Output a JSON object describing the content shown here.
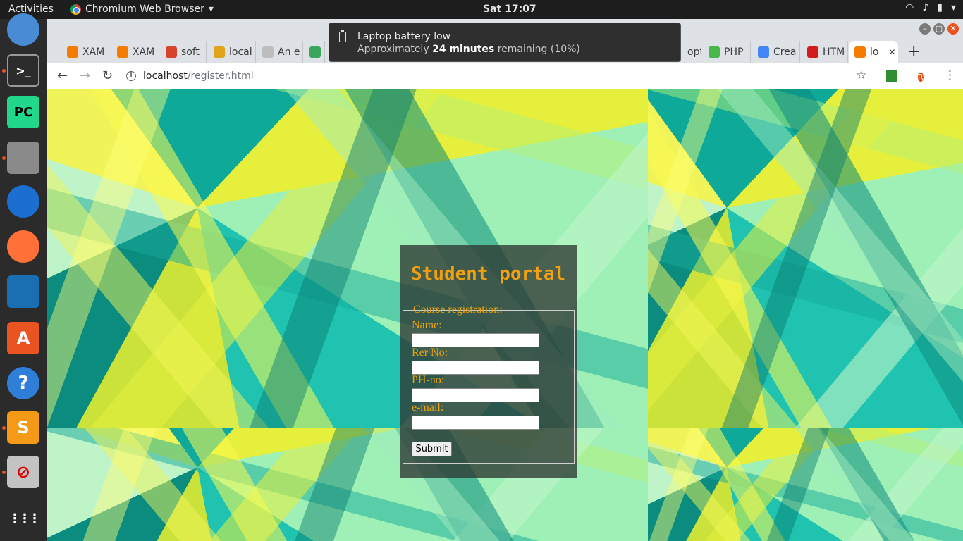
{
  "topbar": {
    "activities": "Activities",
    "app_name": "Chromium Web Browser",
    "app_menu_arrow": "▾",
    "clock": "Sat 17:07"
  },
  "notification": {
    "title": "Laptop battery low",
    "body_prefix": "Approximately ",
    "body_bold": "24 minutes",
    "body_suffix": " remaining (10%)"
  },
  "tabs": [
    {
      "label": "XAM",
      "icon_color": "#f57c00"
    },
    {
      "label": "XAM",
      "icon_color": "#f57c00"
    },
    {
      "label": "soft",
      "icon_color": "#d6452b"
    },
    {
      "label": "local",
      "icon_color": "#e0a41a"
    },
    {
      "label": "An e",
      "icon_color": "#bdbdbd"
    },
    {
      "label": "",
      "icon_color": "#3aa55c"
    },
    {
      "label": "opt",
      "icon_color": "#dee1e6"
    },
    {
      "label": "PHP",
      "icon_color": "#48b74b"
    },
    {
      "label": "Crea",
      "icon_color": "#4285f4"
    },
    {
      "label": "HTM",
      "icon_color": "#d31b1b"
    },
    {
      "label": "lo",
      "icon_color": "#f57c00"
    }
  ],
  "toolbar": {
    "back_icon": "←",
    "forward_icon": "→",
    "reload_icon": "↻",
    "info_icon": "i",
    "url_host": "localhost",
    "url_path": "/register.html",
    "star_icon": "☆",
    "avatar_letter": "R",
    "menu_icon": "⋮",
    "new_tab_icon": "+",
    "close_tab_icon": "✕"
  },
  "window_buttons": {
    "minimize": "–",
    "maximize": "▢",
    "close": "✕"
  },
  "form": {
    "title": "Student portal",
    "legend": "Course registration:",
    "fields": [
      {
        "label": "Name:",
        "value": ""
      },
      {
        "label": "Rer No:",
        "value": ""
      },
      {
        "label": "PH-no:",
        "value": ""
      },
      {
        "label": "e-mail:",
        "value": ""
      }
    ],
    "submit_label": "Submit"
  },
  "dock": [
    {
      "name": "chromium-icon",
      "color": "#4a8bd6"
    },
    {
      "name": "terminal-icon",
      "color": "#2c2c2c"
    },
    {
      "name": "pycharm-icon",
      "color": "#21d789"
    },
    {
      "name": "files-icon",
      "color": "#8a8a8a"
    },
    {
      "name": "thunderbird-icon",
      "color": "#1c6ed1"
    },
    {
      "name": "firefox-icon",
      "color": "#ff7139"
    },
    {
      "name": "writer-icon",
      "color": "#1a6fb3"
    },
    {
      "name": "software-center-icon",
      "color": "#e95420"
    },
    {
      "name": "help-icon",
      "color": "#2f7fd8"
    },
    {
      "name": "sublime-icon",
      "color": "#f49a16"
    },
    {
      "name": "blocked-app-icon",
      "color": "#c3c3c3"
    },
    {
      "name": "show-apps-icon",
      "color": "#2b2b2b"
    }
  ],
  "colors": {
    "accent": "#f0a20a",
    "ubuntu_orange": "#e95420"
  }
}
